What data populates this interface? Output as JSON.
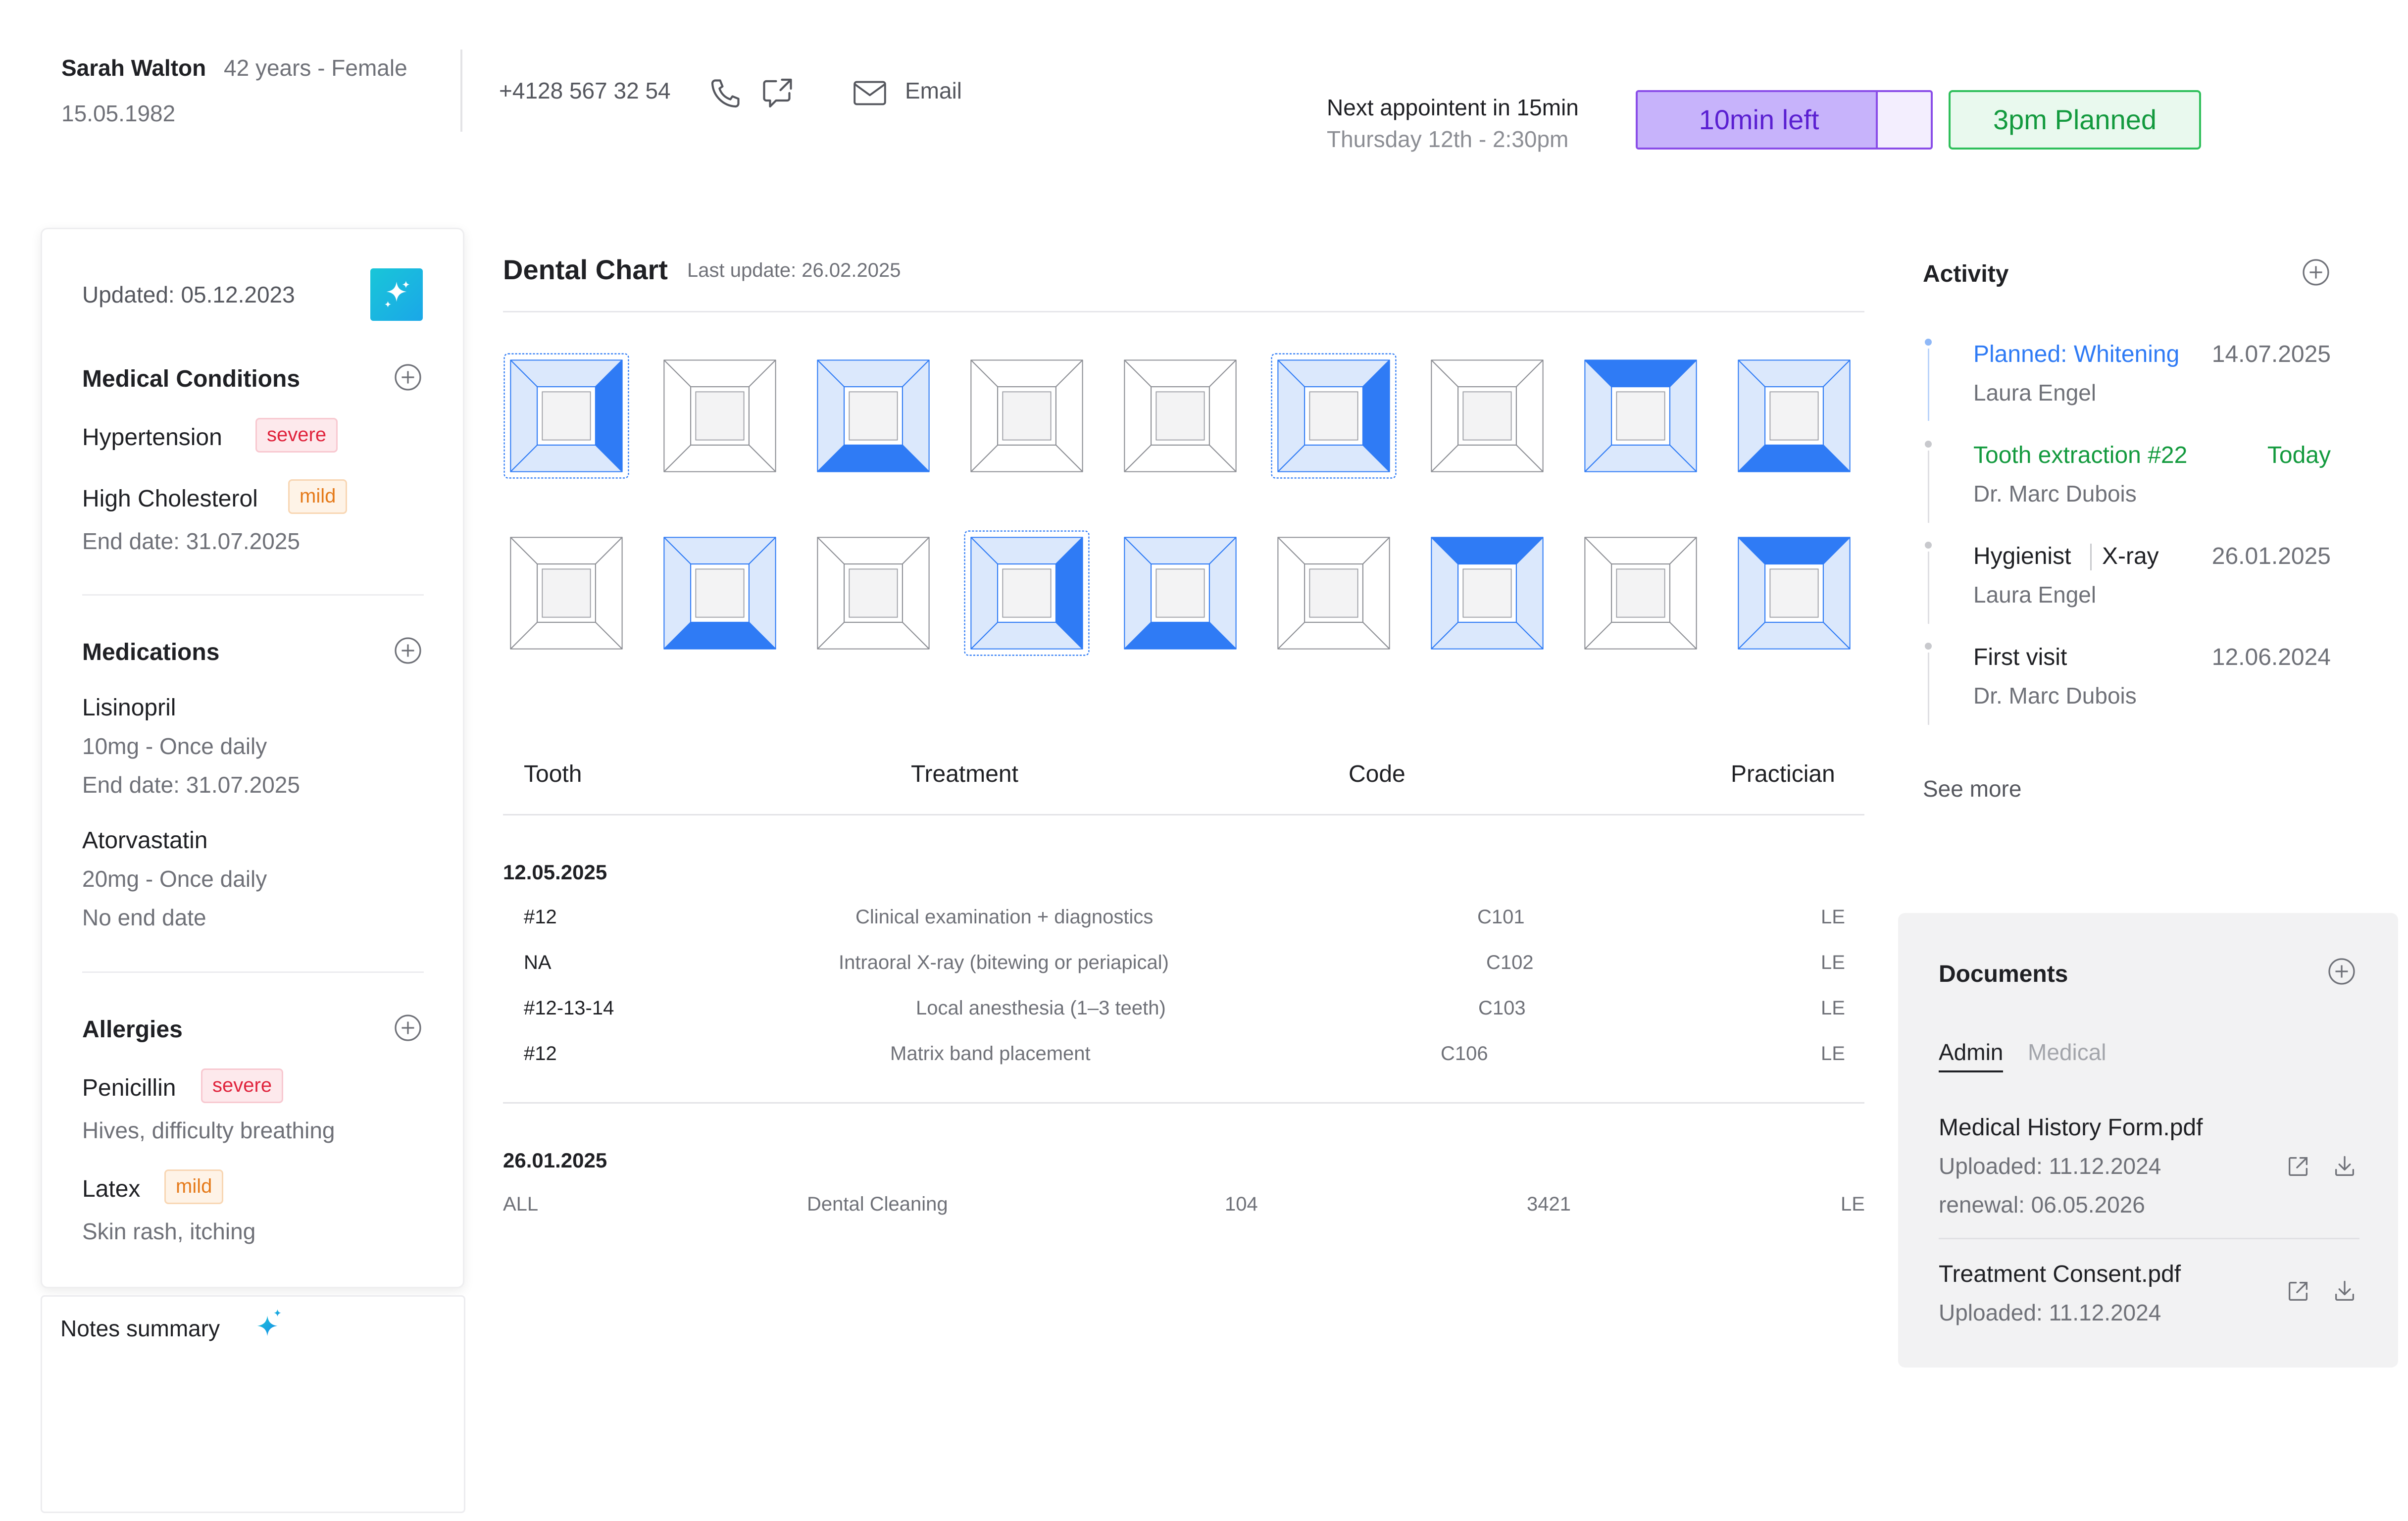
{
  "patient": {
    "name": "Sarah Walton",
    "age_gender": "42 years - Female",
    "dob": "15.05.1982",
    "phone": "+4128 567 32 54",
    "email_label": "Email"
  },
  "appointment": {
    "next_label": "Next appointent in 15min",
    "date": "Thursday 12th - 2:30pm",
    "timer_label": "10min left",
    "timer_progress": 0.82,
    "planned_label": "3pm  Planned"
  },
  "left": {
    "updated": "Updated: 05.12.2023",
    "conditions": {
      "title": "Medical Conditions",
      "items": [
        {
          "name": "Hypertension",
          "badge": "severe"
        },
        {
          "name": "High Cholesterol",
          "badge": "mild",
          "sub": "End date: 31.07.2025"
        }
      ]
    },
    "medications": {
      "title": "Medications",
      "items": [
        {
          "name": "Lisinopril",
          "dose": "10mg - Once daily",
          "end": "End date: 31.07.2025"
        },
        {
          "name": "Atorvastatin",
          "dose": "20mg - Once daily",
          "end": "No end date"
        }
      ]
    },
    "allergies": {
      "title": "Allergies",
      "items": [
        {
          "name": "Penicillin",
          "badge": "severe",
          "sub": "Hives, difficulty breathing"
        },
        {
          "name": "Latex",
          "badge": "mild",
          "sub": "Skin rash, itching"
        }
      ]
    },
    "notes_title": "Notes summary"
  },
  "chart": {
    "title": "Dental Chart",
    "last_update": "Last update: 26.02.2025",
    "teeth_top": [
      {
        "sel": true,
        "fill": [
          "",
          "",
          "",
          "right"
        ],
        "light": [
          "all"
        ]
      },
      {
        "sel": false,
        "fill": [],
        "light": []
      },
      {
        "sel": false,
        "fill": [
          "bottom"
        ],
        "light": [
          "all"
        ]
      },
      {
        "sel": false,
        "fill": [],
        "light": []
      },
      {
        "sel": false,
        "fill": [],
        "light": []
      },
      {
        "sel": true,
        "fill": [
          "right"
        ],
        "light": [
          "all"
        ]
      },
      {
        "sel": false,
        "fill": [],
        "light": []
      },
      {
        "sel": false,
        "fill": [
          "top"
        ],
        "light": [
          "all"
        ]
      },
      {
        "sel": false,
        "fill": [
          "bottom"
        ],
        "light": [
          "all"
        ]
      }
    ],
    "teeth_bottom": [
      {
        "sel": false,
        "fill": [],
        "light": []
      },
      {
        "sel": false,
        "fill": [
          "bottom"
        ],
        "light": [
          "all"
        ]
      },
      {
        "sel": false,
        "fill": [],
        "light": []
      },
      {
        "sel": true,
        "fill": [
          "right"
        ],
        "light": [
          "all"
        ]
      },
      {
        "sel": false,
        "fill": [
          "bottom"
        ],
        "light": [
          "all"
        ]
      },
      {
        "sel": false,
        "fill": [],
        "light": []
      },
      {
        "sel": false,
        "fill": [
          "top"
        ],
        "light": [
          "all"
        ]
      },
      {
        "sel": false,
        "fill": [],
        "light": []
      },
      {
        "sel": false,
        "fill": [
          "top"
        ],
        "light": [
          "all"
        ]
      }
    ]
  },
  "table": {
    "headers": [
      "Tooth",
      "Treatment",
      "Code",
      "Practician"
    ],
    "groups": [
      {
        "date": "12.05.2025",
        "rows": [
          [
            "#12",
            "Clinical examination + diagnostics",
            "C101",
            "LE"
          ],
          [
            "NA",
            "Intraoral X-ray (bitewing or periapical)",
            "C102",
            "LE"
          ],
          [
            "#12-13-14",
            "Local anesthesia (1–3 teeth)",
            "C103",
            "LE"
          ],
          [
            "#12",
            "Matrix band placement",
            "C106",
            "LE"
          ]
        ]
      },
      {
        "date": "26.01.2025",
        "rows": [
          [
            "ALL",
            "Dental Cleaning",
            "104",
            "3421",
            "LE"
          ]
        ]
      }
    ]
  },
  "activity": {
    "title": "Activity",
    "items": [
      {
        "title": "Planned: Whitening",
        "date": "14.07.2025",
        "by": "Laura Engel"
      },
      {
        "title": "Tooth extraction #22",
        "date": "Today",
        "by": "Dr. Marc Dubois"
      },
      {
        "title": "Hygienist",
        "title2": "X-ray",
        "date": "26.01.2025",
        "by": "Laura Engel"
      },
      {
        "title": "First visit",
        "date": "12.06.2024",
        "by": "Dr. Marc Dubois"
      }
    ],
    "see_more": "See more"
  },
  "documents": {
    "title": "Documents",
    "tabs": [
      "Admin",
      "Medical"
    ],
    "items": [
      {
        "name": "Medical History Form.pdf",
        "uploaded": "Uploaded: 11.12.2024",
        "renewal": "renewal: 06.05.2026"
      },
      {
        "name": "Treatment Consent.pdf",
        "uploaded": "Uploaded: 11.12.2024"
      }
    ]
  },
  "colors": {
    "accent_blue": "#2f7bf5",
    "light_blue": "#dbe8fc",
    "purple": "#8a4de8",
    "green": "#139a3e",
    "severe": "#e0243d",
    "mild": "#e57a1a"
  }
}
